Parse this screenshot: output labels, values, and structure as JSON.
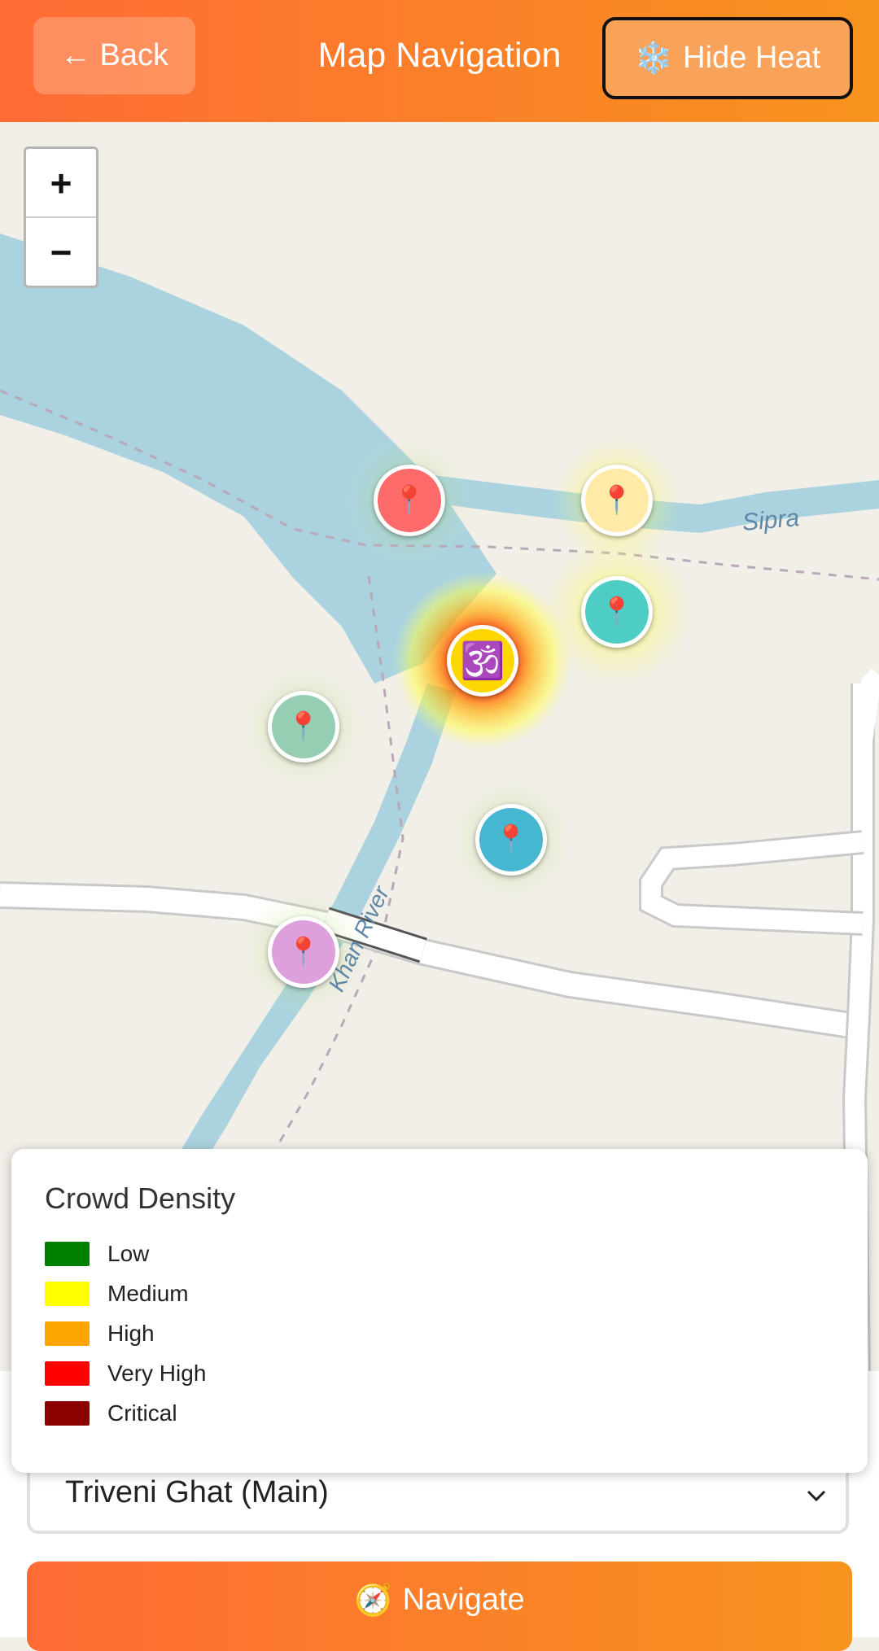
{
  "header": {
    "back_label": "← Back",
    "title": "Map Navigation",
    "heat_icon": "❄️",
    "heat_label": "Hide Heat"
  },
  "map": {
    "zoom_in": "+",
    "zoom_out": "−",
    "river_labels": [
      "Sipra",
      "Khan River"
    ],
    "marker_icon": "📍",
    "center_icon": "🕉️"
  },
  "legend": {
    "title": "Crowd Density",
    "items": [
      {
        "label": "Low",
        "color": "#008000"
      },
      {
        "label": "Medium",
        "color": "#ffff00"
      },
      {
        "label": "High",
        "color": "#ffa500"
      },
      {
        "label": "Very High",
        "color": "#ff0000"
      },
      {
        "label": "Critical",
        "color": "#8b0000"
      }
    ]
  },
  "destination": {
    "selected": "Triveni Ghat (Main)"
  },
  "navigate": {
    "icon": "🧭",
    "label": "Navigate"
  },
  "colors": {
    "accent_start": "#ff6b35",
    "accent_end": "#f7931e",
    "water": "#aad3df"
  }
}
